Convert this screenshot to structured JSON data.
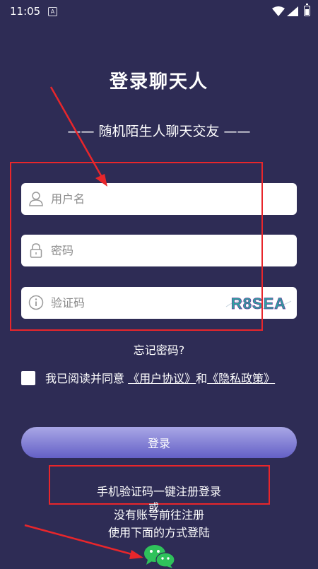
{
  "status_bar": {
    "time": "11:05",
    "notification_glyph": "A"
  },
  "header": {
    "title": "登录聊天人",
    "subtitle": "—— 随机陌生人聊天交友 ——"
  },
  "form": {
    "username_placeholder": "用户名",
    "password_placeholder": "密码",
    "captcha_placeholder": "验证码",
    "captcha_text": "R8SEA"
  },
  "links": {
    "forgot_password": "忘记密码?"
  },
  "agreement": {
    "prefix": "我已阅读并同意",
    "user_agreement": "《用户协议》",
    "and": "和",
    "privacy_policy": "《隐私政策》"
  },
  "buttons": {
    "login": "登录",
    "phone_login": "手机验证码一键注册登录"
  },
  "footer": {
    "or": "或",
    "no_account": "没有账号前往注册",
    "other_methods": "使用下面的方式登陆"
  },
  "icons": {
    "wechat": "wechat-icon"
  },
  "colors": {
    "background": "#2e2c55",
    "annotation": "#e8262b",
    "button_top": "#a9a7e6",
    "button_bottom": "#6460c6",
    "wechat": "#2fc25b"
  }
}
